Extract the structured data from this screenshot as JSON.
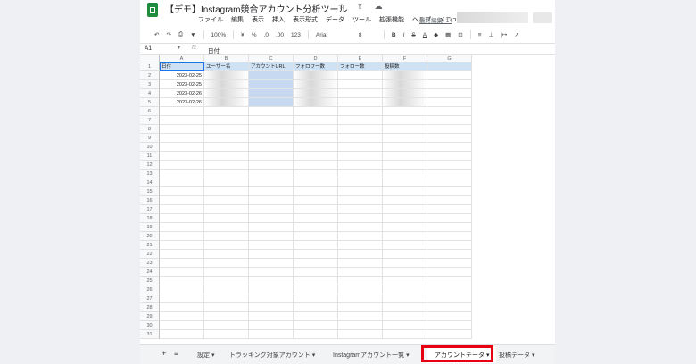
{
  "app": {
    "title": "【デモ】Instagram競合アカウント分析ツール",
    "title_icons": "☆ ⇪ ☁",
    "last_edit": "最終編集: 14"
  },
  "menu": [
    "ファイル",
    "編集",
    "表示",
    "挿入",
    "表示形式",
    "データ",
    "ツール",
    "拡張機能",
    "ヘルプ",
    "メニュー"
  ],
  "toolbar": {
    "undo": "↶",
    "redo": "↷",
    "print": "⎙",
    "paint": "▼",
    "zoom": "100%",
    "currency": "¥",
    "percent": "%",
    "dec_less": ".0",
    "dec_more": ".00",
    "format": "123",
    "font": "Arial",
    "size": "8",
    "bold": "B",
    "italic": "I",
    "strike": "S",
    "color": "A",
    "fill": "◆",
    "borders": "▦",
    "merge": "⊡",
    "align": "≡",
    "valign": "⊥",
    "wrap": "|↦",
    "rotate": "↗"
  },
  "formula_bar": {
    "cell_ref": "A1",
    "fx": "fx",
    "value": "日付"
  },
  "columns": [
    "A",
    "B",
    "C",
    "D",
    "E",
    "F",
    "G"
  ],
  "headers": [
    "日付",
    "ユーザー名",
    "アカウントURL",
    "フォロワー数",
    "フォロー数",
    "投稿数",
    ""
  ],
  "rows": [
    [
      "2023-02-25",
      "",
      "",
      "",
      "",
      "",
      ""
    ],
    [
      "2023-02-25",
      "",
      "",
      "",
      "",
      "",
      ""
    ],
    [
      "2023-02-26",
      "",
      "",
      "",
      "",
      "",
      ""
    ],
    [
      "2023-02-26",
      "",
      "",
      "",
      "",
      "",
      ""
    ]
  ],
  "row_count": 31,
  "sheet_tabs": {
    "add": "+",
    "list": "≡",
    "items": [
      {
        "label": "設定",
        "active": false
      },
      {
        "label": "トラッキング対象アカウント",
        "active": false
      },
      {
        "label": "Instagramアカウント一覧",
        "active": false
      },
      {
        "label": "アカウントデータ",
        "active": true
      },
      {
        "label": "投稿データ",
        "active": false
      }
    ]
  },
  "colors": {
    "highlight": "#e60012",
    "header_fill": "#cfe2f3",
    "brand": "#1e8e3e"
  }
}
